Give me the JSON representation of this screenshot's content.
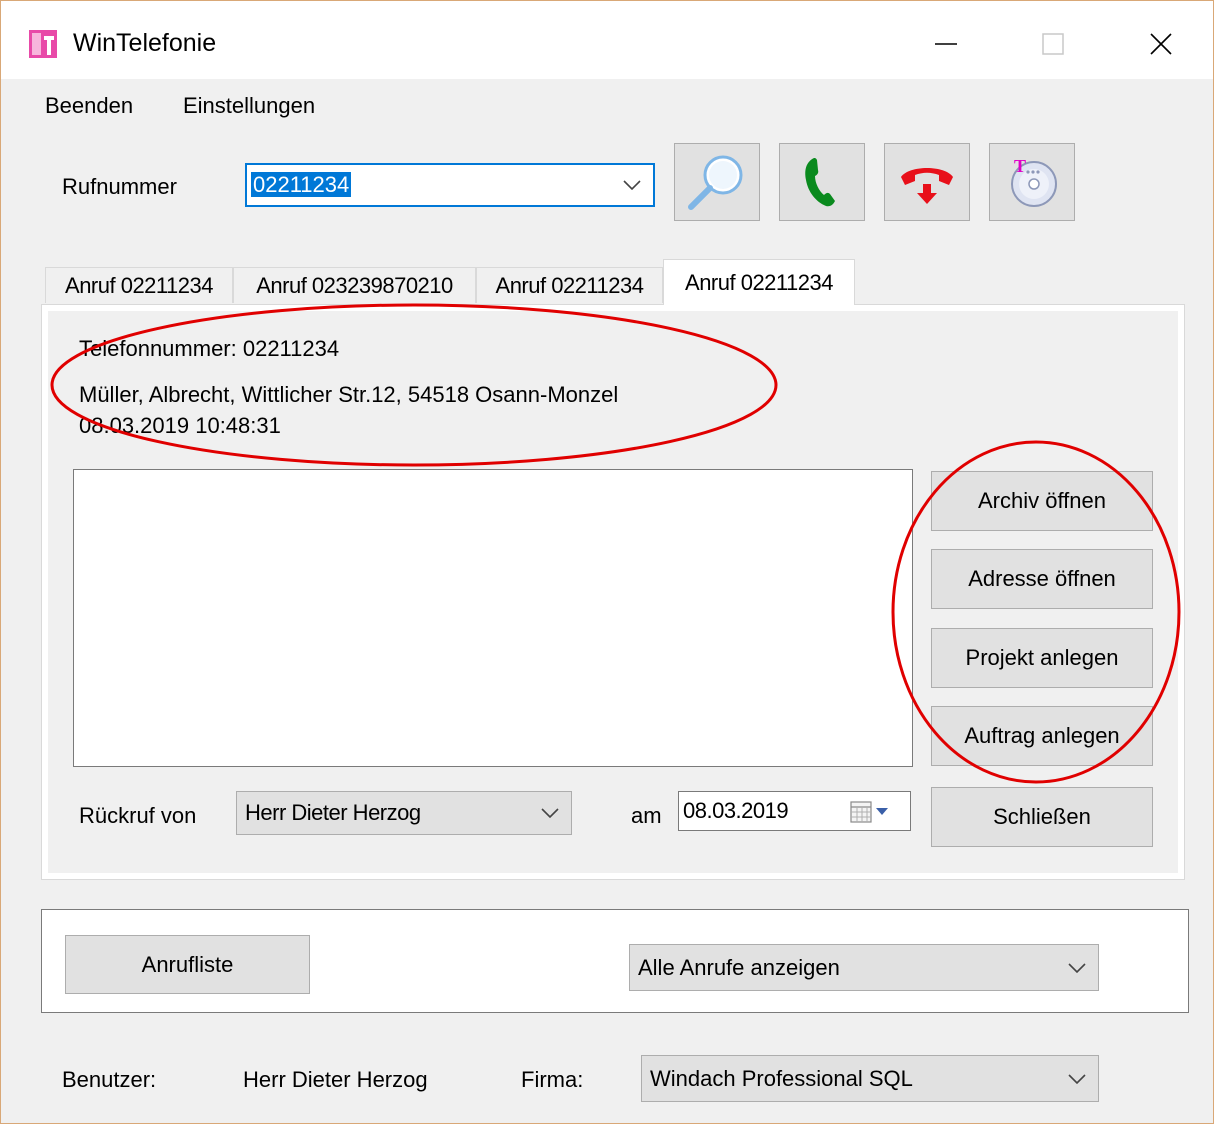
{
  "window": {
    "title": "WinTelefonie",
    "icon": "app-icon",
    "controls": [
      "minimize-icon",
      "maximize-icon",
      "close-icon"
    ]
  },
  "menu": {
    "items": [
      "Beenden",
      "Einstellungen"
    ]
  },
  "toolbar": {
    "number_label": "Rufnummer",
    "number_value": "02211234",
    "buttons": [
      "magnifier-icon",
      "phone-call-icon",
      "hang-up-icon",
      "cd-t-icon"
    ]
  },
  "tabs": [
    {
      "label": "Anruf 02211234"
    },
    {
      "label": "Anruf 023239870210"
    },
    {
      "label": "Anruf 02211234"
    },
    {
      "label": "Anruf 02211234",
      "active": true
    }
  ],
  "call": {
    "phone_line": "Telefonnummer: 02211234",
    "address_line": "Müller, Albrecht, Wittlicher Str.12, 54518 Osann-Monzel",
    "datetime_line": "08.03.2019 10:48:31",
    "notes_value": ""
  },
  "actions": {
    "archive": "Archiv öffnen",
    "address": "Adresse öffnen",
    "project": "Projekt anlegen",
    "order": "Auftrag anlegen",
    "close": "Schließen"
  },
  "callback": {
    "label": "Rückruf von",
    "person": "Herr Dieter Herzog",
    "date_label": "am",
    "date": "08.03.2019"
  },
  "calllist": {
    "button": "Anrufliste",
    "filter": "Alle Anrufe anzeigen"
  },
  "footer": {
    "user_label": "Benutzer:",
    "user": "Herr Dieter Herzog",
    "company_label": "Firma:",
    "company": "Windach Professional SQL"
  },
  "colors": {
    "accent": "#0078d7",
    "annotation": "#e00000",
    "call_green": "#0a8a1e",
    "hangup_red": "#e8101a"
  }
}
